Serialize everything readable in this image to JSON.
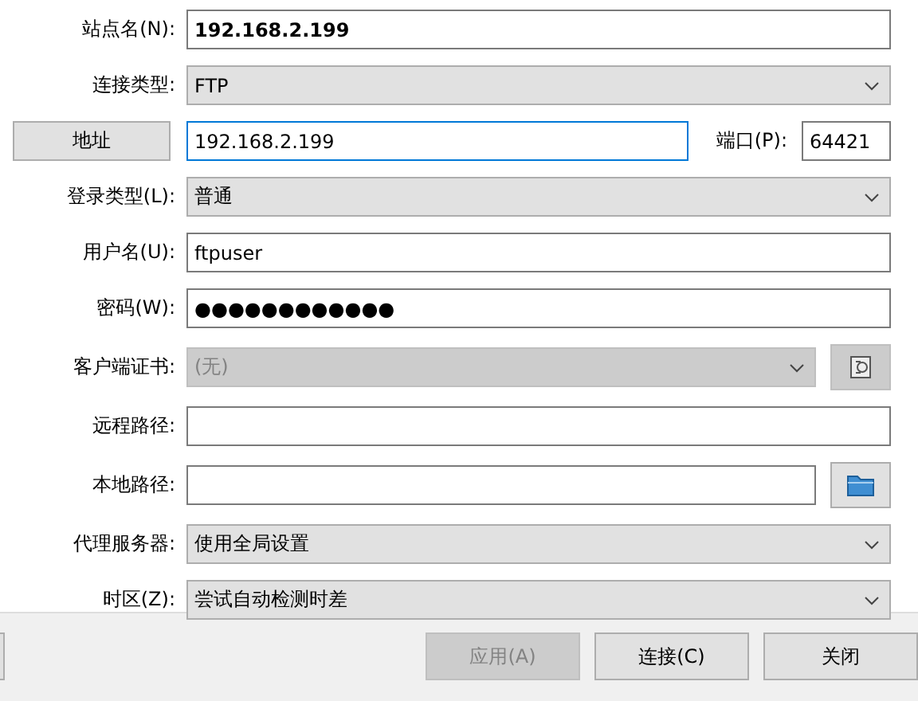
{
  "fields": [
    {
      "kind": "title",
      "label": "站点名(N):",
      "value": "192.168.2.199"
    },
    {
      "kind": "select",
      "label": "连接类型:",
      "value": "FTP",
      "disabled": false
    },
    {
      "kind": "address",
      "button_label": "地址",
      "value": "192.168.2.199",
      "focused": true,
      "port_label": "端口(P):",
      "port_value": "64421"
    },
    {
      "kind": "select",
      "label": "登录类型(L):",
      "value": "普通",
      "disabled": false
    },
    {
      "kind": "text",
      "label": "用户名(U):",
      "value": "ftpuser"
    },
    {
      "kind": "text",
      "label": "密码(W):",
      "value": "●●●●●●●●●●●●"
    },
    {
      "kind": "cert",
      "label": "客户端证书:",
      "value": "(无)",
      "disabled": true
    },
    {
      "kind": "text",
      "label": "远程路径:"
    },
    {
      "kind": "folder",
      "label": "本地路径:"
    },
    {
      "kind": "select",
      "label": "代理服务器:",
      "value": "使用全局设置",
      "disabled": false
    },
    {
      "kind": "select",
      "label": "时区(Z):",
      "value": "尝试自动检测时差",
      "disabled": false
    }
  ],
  "buttons": [
    {
      "label": "应用(A)",
      "disabled": true
    },
    {
      "label": "连接(C)",
      "disabled": false
    },
    {
      "label": "关闭",
      "disabled": false
    }
  ]
}
